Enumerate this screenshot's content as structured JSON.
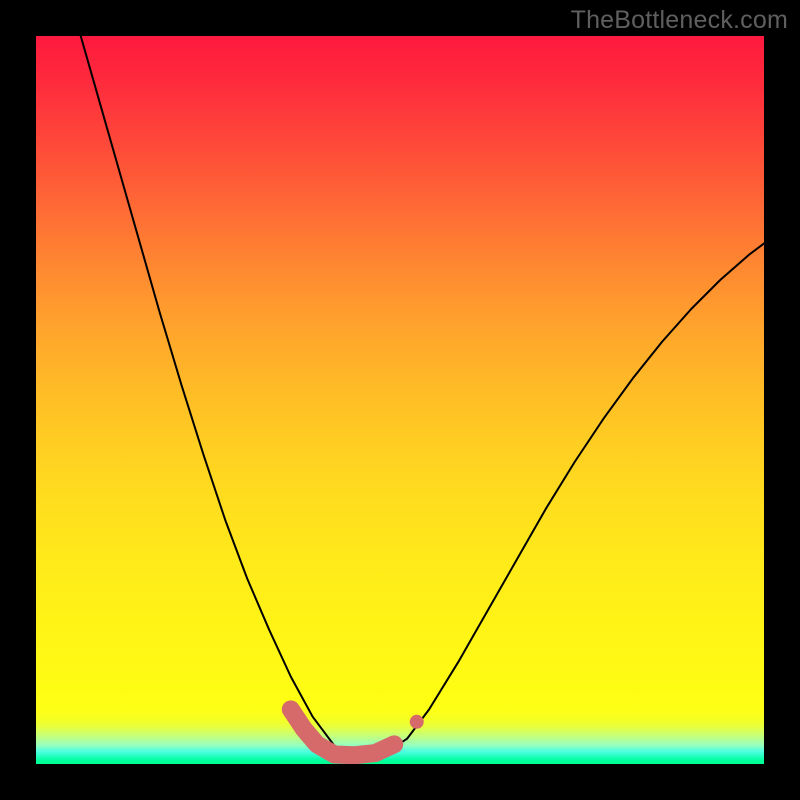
{
  "watermark": "TheBottleneck.com",
  "chart_data": {
    "type": "line",
    "title": "",
    "xlabel": "",
    "ylabel": "",
    "xlim": [
      0,
      1
    ],
    "ylim": [
      0,
      1
    ],
    "note": "Axes are unlabeled in the source image; coordinates are normalized 0–1 within the plot area. Curves form a V shape with the minimum near x≈0.42, y≈0 and a short plateau of accent markers along the bottom around x 0.36–0.50.",
    "series": [
      {
        "name": "left-branch",
        "x": [
          0.05,
          0.08,
          0.11,
          0.14,
          0.17,
          0.2,
          0.23,
          0.26,
          0.29,
          0.32,
          0.35,
          0.38,
          0.41,
          0.43
        ],
        "y": [
          1.04,
          0.935,
          0.83,
          0.725,
          0.62,
          0.52,
          0.425,
          0.335,
          0.255,
          0.185,
          0.12,
          0.065,
          0.025,
          0.01
        ],
        "stroke": "#000000",
        "width": 2
      },
      {
        "name": "right-branch",
        "x": [
          0.43,
          0.48,
          0.51,
          0.54,
          0.58,
          0.62,
          0.66,
          0.7,
          0.74,
          0.78,
          0.82,
          0.86,
          0.9,
          0.94,
          0.98,
          1.0
        ],
        "y": [
          0.01,
          0.015,
          0.035,
          0.075,
          0.14,
          0.21,
          0.28,
          0.35,
          0.415,
          0.475,
          0.53,
          0.58,
          0.625,
          0.665,
          0.7,
          0.715
        ],
        "stroke": "#000000",
        "width": 2
      },
      {
        "name": "accent-plateau",
        "x": [
          0.35,
          0.368,
          0.386,
          0.41,
          0.438,
          0.466,
          0.492
        ],
        "y": [
          0.075,
          0.048,
          0.027,
          0.013,
          0.012,
          0.015,
          0.027
        ],
        "stroke": "#d66a6a",
        "width": 18
      },
      {
        "name": "accent-dot",
        "x": [
          0.523
        ],
        "y": [
          0.058
        ],
        "stroke": "#d66a6a",
        "width": 14
      }
    ],
    "background_gradient": {
      "direction": "top-to-bottom",
      "stops": [
        {
          "pos": 0.0,
          "color": "#fe193e"
        },
        {
          "pos": 0.4,
          "color": "#ffa32c"
        },
        {
          "pos": 0.8,
          "color": "#fff316"
        },
        {
          "pos": 0.94,
          "color": "#e8ff3c"
        },
        {
          "pos": 1.0,
          "color": "#00ff8e"
        }
      ]
    }
  }
}
